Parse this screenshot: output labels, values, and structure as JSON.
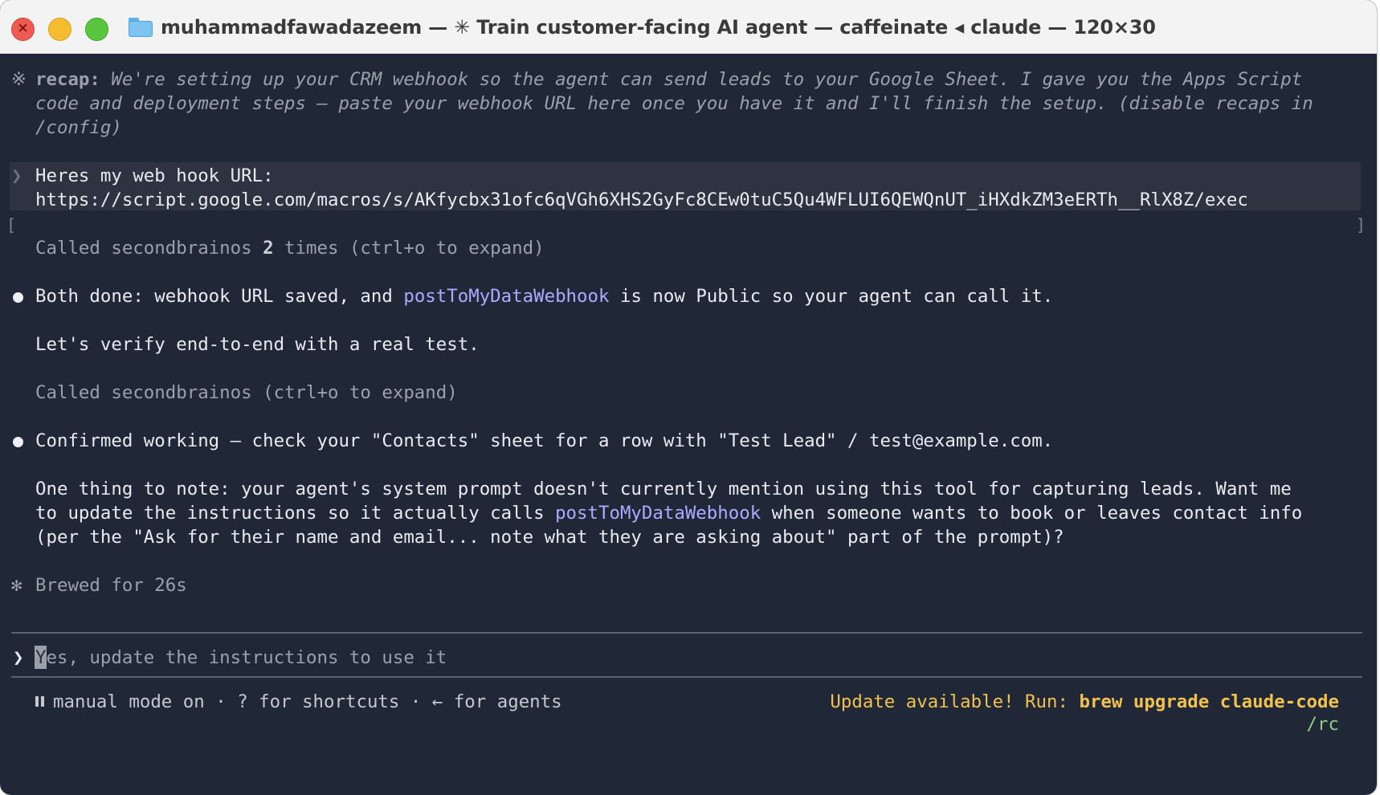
{
  "window": {
    "title": "muhammadfawadazeem — ✳ Train customer-facing AI agent — caffeinate ◂ claude — 120×30",
    "close_glyph": "×"
  },
  "recap": {
    "icon": "※",
    "label": "recap:",
    "line1": " We're setting up your CRM webhook so the agent can send leads to your Google Sheet. I gave you the Apps Script",
    "line2": "code and deployment steps — paste your webhook URL here once you have it and I'll finish the setup. (disable recaps in",
    "line3": "/config)"
  },
  "user_message": {
    "caret": "❯",
    "line1": "Heres my web hook URL:",
    "line2": "https://script.google.com/macros/s/AKfycbx31ofc6qVGh6XHS2GyFc8CEw0tuC5Qu4WFLUI6QEWQnUT_iHXdkZM3eERTh__RlX8Z/exec"
  },
  "brackets": {
    "left": "[",
    "right": "]"
  },
  "tool_call_1": {
    "prefix": "Called secondbrainos ",
    "count": "2",
    "suffix": " times (ctrl+o to expand)"
  },
  "message_1": {
    "before": "Both done: webhook URL saved, and ",
    "highlight": "postToMyDataWebhook",
    "after": " is now Public so your agent can call it."
  },
  "message_1b": "Let's verify end-to-end with a real test.",
  "tool_call_2": "Called secondbrainos (ctrl+o to expand)",
  "message_2": "Confirmed working — check your \"Contacts\" sheet for a row with \"Test Lead\" / test@example.com.",
  "message_3": {
    "line1": "One thing to note: your agent's system prompt doesn't currently mention using this tool for capturing leads. Want me",
    "line2_before": "to update the instructions so it actually calls ",
    "line2_highlight": "postToMyDataWebhook",
    "line2_after": " when someone wants to book or leaves contact info",
    "line3": "(per the \"Ask for their name and email... note what they are asking about\" part of the prompt)?"
  },
  "status": {
    "icon": "✻",
    "text": "Brewed for 26s"
  },
  "input": {
    "caret": "❯",
    "placeholder_first": "Y",
    "placeholder_rest": "es, update the instructions to use it"
  },
  "footer": {
    "mode": "manual mode on",
    "sep1": " · ",
    "shortcuts": "? for shortcuts",
    "sep2": " · ",
    "agents": "← for agents",
    "update_prefix": "Update available! Run: ",
    "update_cmd": "brew upgrade claude-code",
    "rc": "/rc"
  }
}
